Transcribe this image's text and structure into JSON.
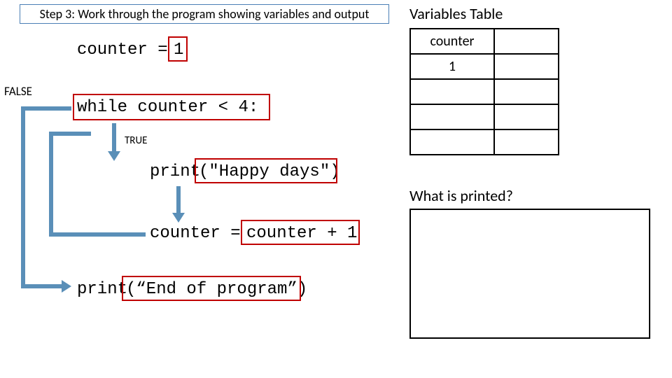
{
  "step_banner": "Step 3: Work through the program showing variables and output",
  "variables_table": {
    "title": "Variables Table",
    "header": "counter",
    "rows": [
      "1",
      "",
      "",
      ""
    ]
  },
  "printed": {
    "label": "What is printed?"
  },
  "code": {
    "line1_left": "counter =",
    "line1_right": "1",
    "line2": "while counter < 4:",
    "line3_left": "print",
    "line3_right": "(\"Happy days\")",
    "line4_left": "counter =",
    "line4_right": "counter + 1",
    "line5_left": "print",
    "line5_right": "(“End of program”)"
  },
  "labels": {
    "false": "FALSE",
    "true": "TRUE"
  }
}
